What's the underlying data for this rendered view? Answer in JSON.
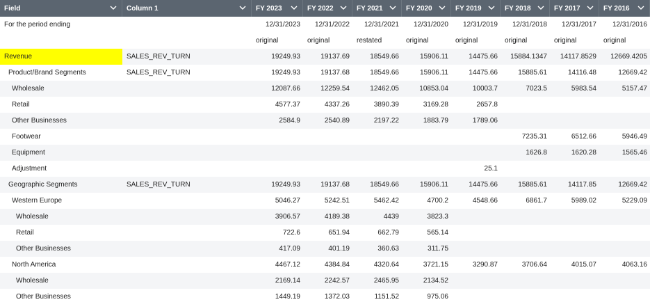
{
  "header": {
    "columns": [
      "Field",
      "Column 1",
      "FY 2023",
      "FY 2022",
      "FY 2021",
      "FY 2020",
      "FY 2019",
      "FY 2018",
      "FY 2017",
      "FY 2016"
    ]
  },
  "period_row": {
    "label": "For the period ending",
    "values": [
      "12/31/2023",
      "12/31/2022",
      "12/31/2021",
      "12/31/2020",
      "12/31/2019",
      "12/31/2018",
      "12/31/2017",
      "12/31/2016"
    ]
  },
  "status_row": {
    "values": [
      "original",
      "original",
      "restated",
      "original",
      "original",
      "original",
      "original",
      "original"
    ]
  },
  "rows": [
    {
      "field": "Revenue",
      "code": "SALES_REV_TURN",
      "values": [
        "19249.93",
        "19137.69",
        "18549.66",
        "15906.11",
        "14475.66",
        "15884.1347",
        "14117.8529",
        "12669.4205"
      ]
    },
    {
      "field": "Product/Brand Segments",
      "code": "SALES_REV_TURN",
      "values": [
        "19249.93",
        "19137.68",
        "18549.66",
        "15906.11",
        "14475.66",
        "15885.61",
        "14116.48",
        "12669.42"
      ]
    },
    {
      "field": "Wholesale",
      "code": "",
      "values": [
        "12087.66",
        "12259.54",
        "12462.05",
        "10853.04",
        "10003.7",
        "7023.5",
        "5983.54",
        "5157.47"
      ]
    },
    {
      "field": "Retail",
      "code": "",
      "values": [
        "4577.37",
        "4337.26",
        "3890.39",
        "3169.28",
        "2657.8",
        "",
        "",
        ""
      ]
    },
    {
      "field": "Other Businesses",
      "code": "",
      "values": [
        "2584.9",
        "2540.89",
        "2197.22",
        "1883.79",
        "1789.06",
        "",
        "",
        ""
      ]
    },
    {
      "field": "Footwear",
      "code": "",
      "values": [
        "",
        "",
        "",
        "",
        "",
        "7235.31",
        "6512.66",
        "5946.49"
      ]
    },
    {
      "field": "Equipment",
      "code": "",
      "values": [
        "",
        "",
        "",
        "",
        "",
        "1626.8",
        "1620.28",
        "1565.46"
      ]
    },
    {
      "field": "Adjustment",
      "code": "",
      "values": [
        "",
        "",
        "",
        "",
        "25.1",
        "",
        "",
        ""
      ]
    },
    {
      "field": "Geographic Segments",
      "code": "SALES_REV_TURN",
      "values": [
        "19249.93",
        "19137.68",
        "18549.66",
        "15906.11",
        "14475.66",
        "15885.61",
        "14117.85",
        "12669.42"
      ]
    },
    {
      "field": "Western Europe",
      "code": "",
      "values": [
        "5046.27",
        "5242.51",
        "5462.42",
        "4700.2",
        "4548.66",
        "6861.7",
        "5989.02",
        "5229.09"
      ]
    },
    {
      "field": "Wholesale",
      "code": "",
      "values": [
        "3906.57",
        "4189.38",
        "4439",
        "3823.3",
        "",
        "",
        "",
        ""
      ]
    },
    {
      "field": "Retail",
      "code": "",
      "values": [
        "722.6",
        "651.94",
        "662.79",
        "565.14",
        "",
        "",
        "",
        ""
      ]
    },
    {
      "field": "Other Businesses",
      "code": "",
      "values": [
        "417.09",
        "401.19",
        "360.63",
        "311.75",
        "",
        "",
        "",
        ""
      ]
    },
    {
      "field": "North America",
      "code": "",
      "values": [
        "4467.12",
        "4384.84",
        "4320.64",
        "3721.15",
        "3290.87",
        "3706.64",
        "4015.07",
        "4063.16"
      ]
    },
    {
      "field": "Wholesale",
      "code": "",
      "values": [
        "2169.14",
        "2242.57",
        "2465.95",
        "2134.52",
        "",
        "",
        "",
        ""
      ]
    },
    {
      "field": "Other Businesses",
      "code": "",
      "values": [
        "1449.19",
        "1372.03",
        "1151.52",
        "975.06",
        "",
        "",
        "",
        ""
      ]
    }
  ],
  "icons": {
    "header_sort": "chevron-down-icon"
  },
  "colors": {
    "header_bg": "#5b6570",
    "highlight": "#ffff00",
    "alt_row": "#f4f5f7"
  }
}
